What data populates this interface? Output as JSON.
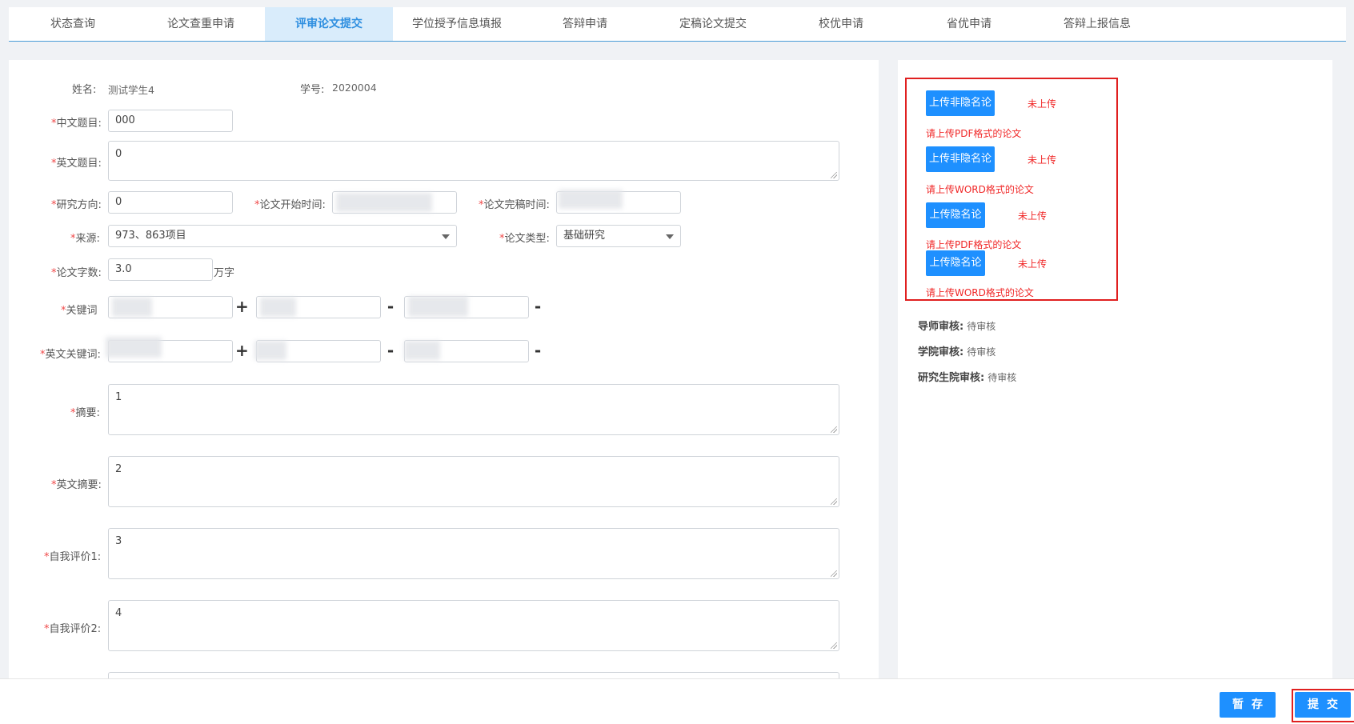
{
  "tabs": [
    {
      "label": "状态查询"
    },
    {
      "label": "论文查重申请"
    },
    {
      "label": "评审论文提交"
    },
    {
      "label": "学位授予信息填报"
    },
    {
      "label": "答辩申请"
    },
    {
      "label": "定稿论文提交"
    },
    {
      "label": "校优申请"
    },
    {
      "label": "省优申请"
    },
    {
      "label": "答辩上报信息"
    }
  ],
  "active_tab": "评审论文提交",
  "required_mark": "*",
  "student": {
    "name_label": "姓名:",
    "name_value": "测试学生4",
    "id_label": "学号:",
    "id_value": "2020004"
  },
  "form": {
    "cn_title_label": "中文题目:",
    "cn_title_value": "000",
    "en_title_label": "英文题目:",
    "en_title_value": "0",
    "direction_label": "研究方向:",
    "direction_value": "0",
    "start_time_label": "论文开始时间:",
    "finish_time_label": "论文完稿时间:",
    "source_label": "来源:",
    "source_value": "973、863项目",
    "type_label": "论文类型:",
    "type_value": "基础研究",
    "word_count_label": "论文字数:",
    "word_count_value": "3.0",
    "word_count_unit": "万字",
    "keywords_label": "关键词",
    "en_keywords_label": "英文关键词:",
    "add_symbol": "+",
    "remove_symbol": "-",
    "abstract_label": "摘要:",
    "abstract_value": "1",
    "en_abstract_label": "英文摘要:",
    "en_abstract_value": "2",
    "self_eval1_label": "自我评价1:",
    "self_eval1_value": "3",
    "self_eval2_label": "自我评价2:",
    "self_eval2_value": "4"
  },
  "uploads": [
    {
      "button": "上传非隐名论文",
      "status": "未上传",
      "hint": "请上传PDF格式的论文"
    },
    {
      "button": "上传非隐名论文",
      "status": "未上传",
      "hint": "请上传WORD格式的论文"
    },
    {
      "button": "上传隐名论文",
      "status": "未上传",
      "hint": "请上传PDF格式的论文"
    },
    {
      "button": "上传隐名论文",
      "status": "未上传",
      "hint": "请上传WORD格式的论文"
    }
  ],
  "reviews": [
    {
      "label": "导师审核:",
      "status": "待审核"
    },
    {
      "label": "学院审核:",
      "status": "待审核"
    },
    {
      "label": "研究生院审核:",
      "status": "待审核"
    }
  ],
  "footer": {
    "save_label": "暂存",
    "submit_label": "提交"
  },
  "colors": {
    "accent": "#1e90ff",
    "active_tab_bg": "#d9ecfb",
    "error": "#f02828",
    "highlight_box": "#e02020"
  }
}
